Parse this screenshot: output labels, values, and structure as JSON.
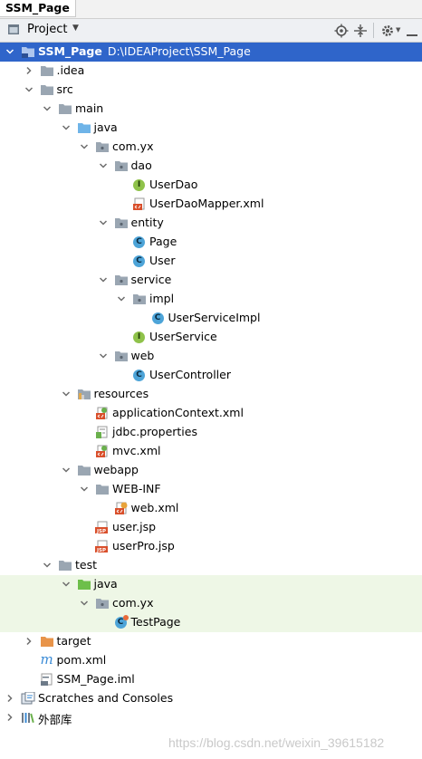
{
  "breadcrumb": {
    "project": "SSM_Page"
  },
  "toolbar": {
    "title": "Project",
    "icons": [
      "locate-icon",
      "collapse-all-icon",
      "settings-icon",
      "hide-icon"
    ]
  },
  "tree": {
    "root": {
      "name": "SSM_Page",
      "path": "D:\\IDEAProject\\SSM_Page"
    },
    "nodes": [
      {
        "label": ".idea"
      },
      {
        "label": "src"
      },
      {
        "label": "main"
      },
      {
        "label": "java"
      },
      {
        "label": "com.yx"
      },
      {
        "label": "dao"
      },
      {
        "label": "UserDao"
      },
      {
        "label": "UserDaoMapper.xml"
      },
      {
        "label": "entity"
      },
      {
        "label": "Page"
      },
      {
        "label": "User"
      },
      {
        "label": "service"
      },
      {
        "label": "impl"
      },
      {
        "label": "UserServiceImpl"
      },
      {
        "label": "UserService"
      },
      {
        "label": "web"
      },
      {
        "label": "UserController"
      },
      {
        "label": "resources"
      },
      {
        "label": "applicationContext.xml"
      },
      {
        "label": "jdbc.properties"
      },
      {
        "label": "mvc.xml"
      },
      {
        "label": "webapp"
      },
      {
        "label": "WEB-INF"
      },
      {
        "label": "web.xml"
      },
      {
        "label": "user.jsp"
      },
      {
        "label": "userPro.jsp"
      },
      {
        "label": "test"
      },
      {
        "label": "java"
      },
      {
        "label": "com.yx"
      },
      {
        "label": "TestPage"
      },
      {
        "label": "target"
      },
      {
        "label": "pom.xml"
      },
      {
        "label": "SSM_Page.iml"
      },
      {
        "label": "Scratches and Consoles"
      },
      {
        "label": "外部库"
      }
    ]
  },
  "badges": {
    "class": "C",
    "interface": "I",
    "maven": "m",
    "jsp": "JSP"
  },
  "watermark": "https://blog.csdn.net/weixin_39615182",
  "colors": {
    "selection": "#2f65ca",
    "folder": "#9aa6b2",
    "source_folder": "#6fb4e8",
    "test_folder": "#6dbf4a",
    "excluded_folder": "#e8944a",
    "class_badge": "#4da4d8",
    "interface_badge": "#8fc24a"
  }
}
